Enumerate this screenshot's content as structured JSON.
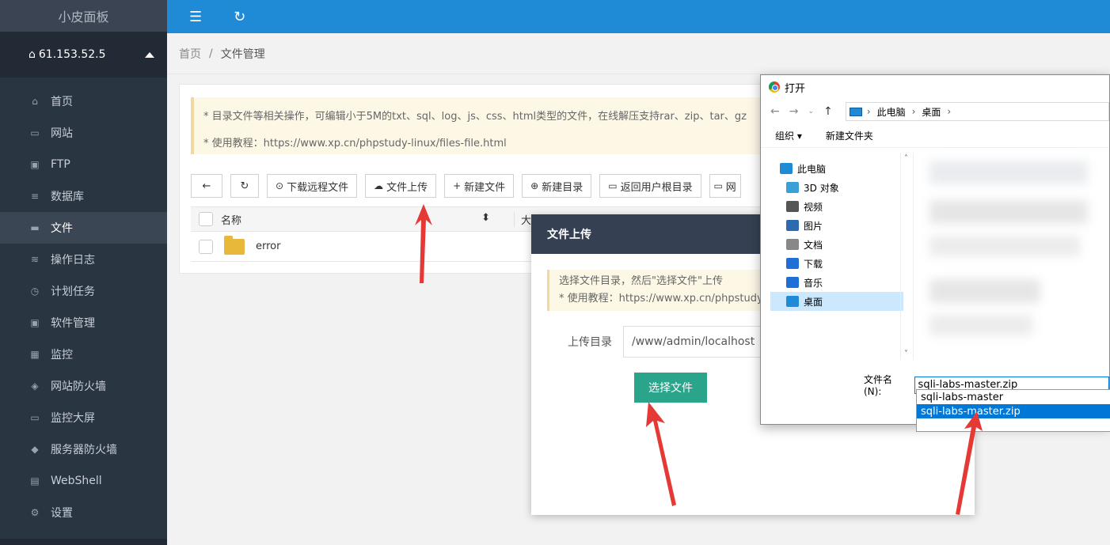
{
  "sidebar": {
    "brand": "小皮面板",
    "server_ip": "61.153.52.5",
    "items": [
      {
        "label": "首页",
        "icon": "home-icon"
      },
      {
        "label": "网站",
        "icon": "monitor-icon"
      },
      {
        "label": "FTP",
        "icon": "ftp-icon"
      },
      {
        "label": "数据库",
        "icon": "database-icon"
      },
      {
        "label": "文件",
        "icon": "folder-icon",
        "active": true
      },
      {
        "label": "操作日志",
        "icon": "layers-icon"
      },
      {
        "label": "计划任务",
        "icon": "clock-icon"
      },
      {
        "label": "软件管理",
        "icon": "download-box-icon"
      },
      {
        "label": "监控",
        "icon": "chart-icon"
      },
      {
        "label": "网站防火墙",
        "icon": "shield-icon"
      },
      {
        "label": "监控大屏",
        "icon": "screen-icon"
      },
      {
        "label": "服务器防火墙",
        "icon": "shield-half-icon"
      },
      {
        "label": "WebShell",
        "icon": "terminal-icon"
      },
      {
        "label": "设置",
        "icon": "gear-icon"
      }
    ]
  },
  "breadcrumb": {
    "home": "首页",
    "sep": "/",
    "current": "文件管理"
  },
  "notice": {
    "line1": "* 目录文件等相关操作，可编辑小于5M的txt、sql、log、js、css、html类型的文件，在线解压支持rar、zip、tar、gz",
    "line2": "* 使用教程：https://www.xp.cn/phpstudy-linux/files-file.html"
  },
  "toolbar": {
    "download_remote": "下载远程文件",
    "upload": "文件上传",
    "new_file": "新建文件",
    "new_dir": "新建目录",
    "back_home": "返回用户根目录",
    "web_partial": "网"
  },
  "table": {
    "col_name": "名称",
    "col_size_partial": "大",
    "rows": [
      {
        "name": "error"
      }
    ]
  },
  "modal": {
    "title": "文件上传",
    "tip1": "选择文件目录，然后\"选择文件\"上传",
    "tip2": "* 使用教程：https://www.xp.cn/phpstudy-",
    "dir_label": "上传目录",
    "dir_value": "/www/admin/localhost",
    "choose_btn": "选择文件"
  },
  "dialog": {
    "title": "打开",
    "path": [
      "此电脑",
      "桌面"
    ],
    "organize": "组织",
    "new_folder": "新建文件夹",
    "tree": [
      {
        "label": "此电脑",
        "root": true
      },
      {
        "label": "3D 对象"
      },
      {
        "label": "视频"
      },
      {
        "label": "图片"
      },
      {
        "label": "文档"
      },
      {
        "label": "下载"
      },
      {
        "label": "音乐"
      },
      {
        "label": "桌面",
        "selected": true
      }
    ],
    "filename_label": "文件名(N):",
    "filename_value": "sqli-labs-master.zip",
    "suggestions": [
      "sqli-labs-master",
      "sqli-labs-master.zip"
    ],
    "highlighted_suggestion": 1
  },
  "colors": {
    "sidebar_bg": "#2a3542",
    "topbar": "#1f8ad6",
    "primary_btn": "#2ba48c",
    "modal_header": "#354153",
    "arrow": "#e53935"
  }
}
